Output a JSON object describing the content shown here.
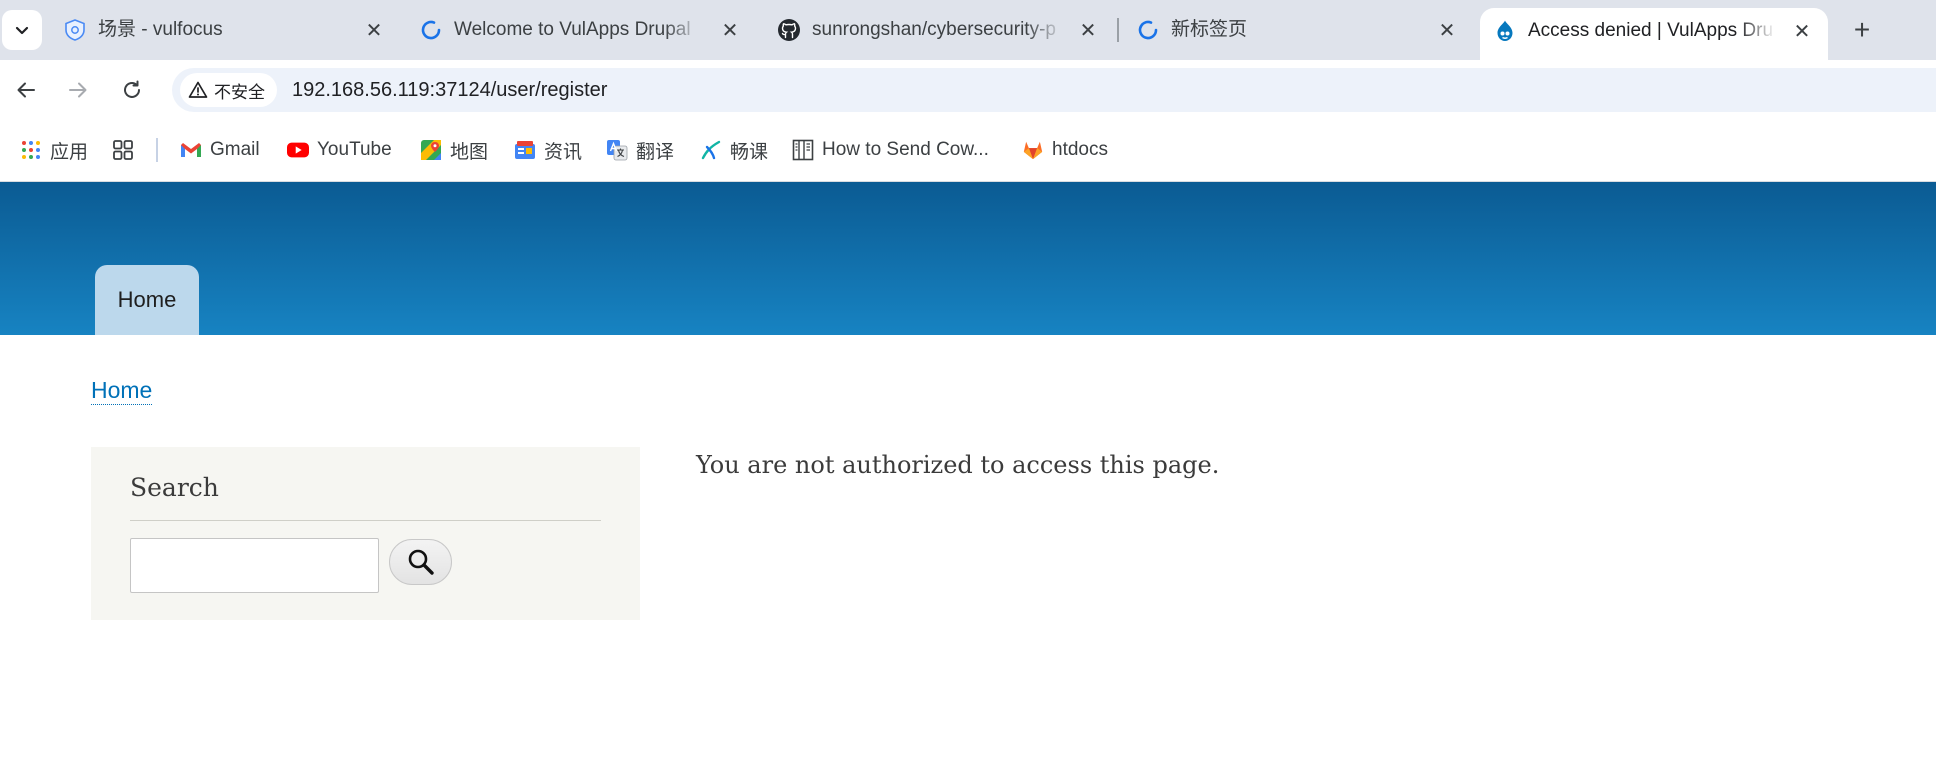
{
  "browser": {
    "tabs": [
      {
        "title": "场景 - vulfocus",
        "icon": "vulfocus-shield-icon",
        "active": false
      },
      {
        "title": "Welcome to VulApps Drupal",
        "icon": "loading-spinner-icon",
        "active": false
      },
      {
        "title": "sunrongshan/cybersecurity-p",
        "icon": "github-icon",
        "active": false
      },
      {
        "title": "新标签页",
        "icon": "loading-spinner-icon",
        "active": false
      },
      {
        "title": "Access denied | VulApps Dru",
        "icon": "drupal-icon",
        "active": true
      }
    ],
    "new_tab_label": "+",
    "close_label": "✕"
  },
  "toolbar": {
    "security_label": "不安全",
    "url_host": "192.168.56.119",
    "url_rest": ":37124/user/register"
  },
  "bookmarks": [
    {
      "label": "应用",
      "icon": "apps-grid-icon"
    },
    {
      "label": "",
      "icon": "tab-groups-icon"
    },
    {
      "label": "Gmail",
      "icon": "gmail-icon"
    },
    {
      "label": "YouTube",
      "icon": "youtube-icon"
    },
    {
      "label": "地图",
      "icon": "maps-icon"
    },
    {
      "label": "资讯",
      "icon": "news-icon"
    },
    {
      "label": "翻译",
      "icon": "translate-icon"
    },
    {
      "label": "畅课",
      "icon": "changke-icon"
    },
    {
      "label": "How to Send Cow...",
      "icon": "book-icon"
    },
    {
      "label": "htdocs",
      "icon": "gitlab-icon"
    }
  ],
  "page": {
    "primary_menu": {
      "home_label": "Home"
    },
    "breadcrumb": {
      "home_label": "Home"
    },
    "sidebar": {
      "search_title": "Search",
      "search_value": ""
    },
    "message": "You are not authorized to access this page."
  },
  "colors": {
    "header_top": "#0b5b93",
    "header_bottom": "#1783c2",
    "active_menu_tab": "#bcd8ec",
    "link": "#0071b8",
    "sidebar_bg": "#f6f6f2"
  }
}
